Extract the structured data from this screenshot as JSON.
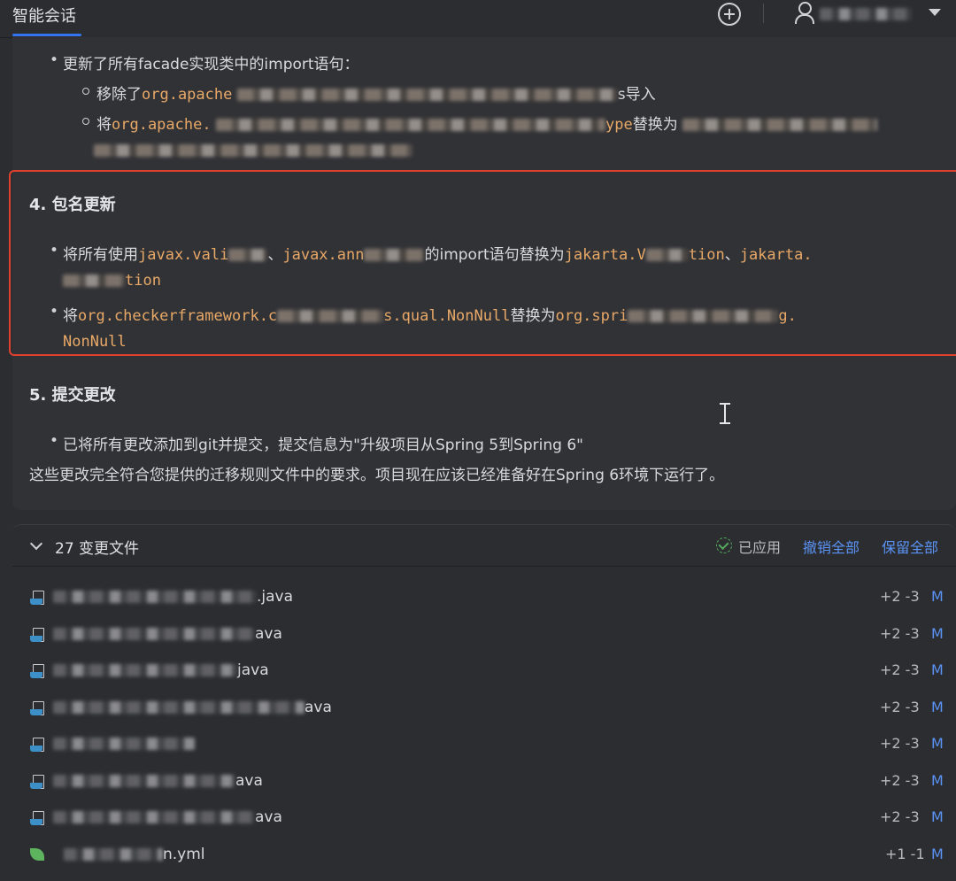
{
  "header": {
    "tab_title": "智能会话",
    "new_chat_icon": "plus-circle-icon",
    "user_icon": "user-icon",
    "menu_icon": "caret-down-icon"
  },
  "message": {
    "facade_line": "更新了所有facade实现类中的import语句：",
    "sub1_prefix": "移除了",
    "sub1_code": "org.apache",
    "sub1_suffix": "s导入",
    "sub2_prefix": "将",
    "sub2_code": "org.apache.",
    "sub2_code_end": "ype",
    "sub2_suffix": "替换为",
    "section4_title": "4. 包名更新",
    "s4_b1_prefix": "将所有使用",
    "s4_b1_code1": "javax.vali",
    "s4_b1_sep1": "、",
    "s4_b1_code2": "javax.ann",
    "s4_b1_mid": "的import语句替换为",
    "s4_b1_code3": "jakarta.V",
    "s4_b1_code3_end": "tion",
    "s4_b1_sep2": "、",
    "s4_b1_code4": "jakarta.",
    "s4_b1_line2_end": "tion",
    "s4_b2_prefix": "将",
    "s4_b2_code1": "org.checkerframework.c",
    "s4_b2_code1_end": "s.qual.NonNull",
    "s4_b2_mid": "替换为",
    "s4_b2_code2": "org.spri",
    "s4_b2_code2_end": "g.",
    "s4_b2_line2": "NonNull",
    "section5_title": "5. 提交更改",
    "s5_b1": "已将所有更改添加到git并提交，提交信息为\"升级项目从Spring 5到Spring 6\"",
    "summary": "这些更改完全符合您提供的迁移规则文件中的要求。项目现在应该已经准备好在Spring 6环境下运行了。"
  },
  "changes": {
    "title": "27 变更文件",
    "applied": "已应用",
    "undo_all": "撤销全部",
    "keep_all": "保留全部",
    "files": [
      {
        "name_suffix": ".java",
        "stat": "+2 -3",
        "status": "M",
        "icon": "java-file-icon"
      },
      {
        "name_suffix": "ava",
        "stat": "+2 -3",
        "status": "M",
        "icon": "java-file-icon"
      },
      {
        "name_suffix": "java",
        "stat": "+2 -3",
        "status": "M",
        "icon": "java-file-icon"
      },
      {
        "name_suffix": "ava",
        "stat": "+2 -3",
        "status": "M",
        "icon": "java-file-icon"
      },
      {
        "name_suffix": "",
        "stat": "+2 -3",
        "status": "M",
        "icon": "java-file-icon"
      },
      {
        "name_suffix": "ava",
        "stat": "+2 -3",
        "status": "M",
        "icon": "java-file-icon"
      },
      {
        "name_suffix": "ava",
        "stat": "+2 -3",
        "status": "M",
        "icon": "java-file-icon"
      },
      {
        "name_suffix": "n.yml",
        "stat": "+1 -1",
        "status": "M",
        "icon": "spring-leaf-icon"
      }
    ]
  }
}
